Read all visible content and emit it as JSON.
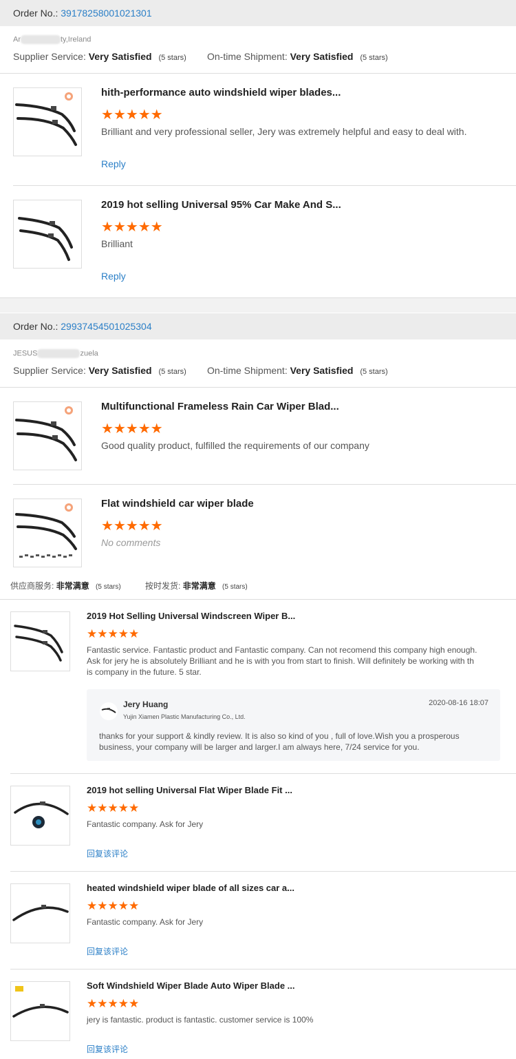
{
  "orders": [
    {
      "order_label": "Order No.:",
      "order_number": "39178258001021301",
      "buyer_prefix": "Ar",
      "buyer_suffix": "ty,Ireland",
      "supplier_label": "Supplier Service:",
      "supplier_value": "Very Satisfied",
      "supplier_stars": "(5 stars)",
      "shipment_label": "On-time Shipment:",
      "shipment_value": "Very Satisfied",
      "shipment_stars": "(5 stars)",
      "items": [
        {
          "title": "hith-performance auto windshield wiper blades...",
          "rating": 5,
          "comment": "Brilliant and very professional seller, Jery was extremely helpful and easy to deal with.",
          "reply": "Reply"
        },
        {
          "title": "2019 hot selling Universal 95% Car Make And S...",
          "rating": 5,
          "comment": "Brilliant",
          "reply": "Reply"
        }
      ]
    },
    {
      "order_label": "Order No.:",
      "order_number": "29937454501025304",
      "buyer_prefix": "JESUS",
      "buyer_suffix": "zuela",
      "supplier_label": "Supplier Service:",
      "supplier_value": "Very Satisfied",
      "supplier_stars": "(5 stars)",
      "shipment_label": "On-time Shipment:",
      "shipment_value": "Very Satisfied",
      "shipment_stars": "(5 stars)",
      "items": [
        {
          "title": "Multifunctional Frameless Rain Car Wiper Blad...",
          "rating": 5,
          "comment": "Good quality product, fulfilled the requirements of our company"
        },
        {
          "title": "Flat windshield car wiper blade",
          "rating": 5,
          "comment": "No comments"
        }
      ]
    }
  ],
  "cn_section": {
    "supplier_label": "供应商服务:",
    "supplier_value": "非常满意",
    "supplier_stars": "(5 stars)",
    "shipment_label": "按时发货:",
    "shipment_value": "非常满意",
    "shipment_stars": "(5 stars)",
    "items": [
      {
        "title": "2019 Hot Selling Universal Windscreen Wiper B...",
        "rating": 5,
        "comment_lines": [
          "Fantastic service. Fantastic product and Fantastic company. Can not recomend this company high enough.",
          "Ask for jery he is absolutely Brilliant and he is with you from start to finish. Will definitely be working with th",
          "is company in the future. 5 star."
        ],
        "seller_reply": {
          "name": "Jery Huang",
          "company": "Yujin Xiamen Plastic Manufacturing Co., Ltd.",
          "date": "2020-08-16 18:07",
          "text_lines": [
            "thanks for your support & kindly review. It is also so kind of you , full of love.Wish you a prosperous",
            "business, your company will be larger and larger.I am always here, 7/24 service for you."
          ]
        }
      },
      {
        "title": "2019 hot selling Universal Flat Wiper Blade Fit ...",
        "rating": 5,
        "comment": "Fantastic company. Ask for Jery",
        "reply": "回复该评论"
      },
      {
        "title": "heated windshield wiper blade of all sizes car a...",
        "rating": 5,
        "comment": "Fantastic company. Ask for Jery",
        "reply": "回复该评论"
      },
      {
        "title": "Soft Windshield Wiper Blade Auto Wiper Blade ...",
        "rating": 5,
        "comment": "jery is fantastic. product is fantastic. customer service is 100%",
        "reply": "回复该评论"
      }
    ]
  },
  "star_glyph": "★",
  "colors": {
    "accent_link": "#2b7fc7",
    "star": "#ff6a00",
    "header_bg": "#ececec"
  }
}
